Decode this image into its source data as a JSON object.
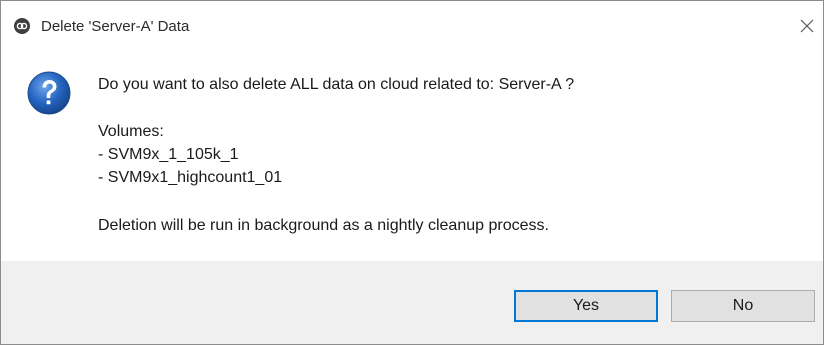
{
  "window": {
    "title": "Delete 'Server-A' Data",
    "app_icon": "app-logo-icon",
    "close_icon": "close-icon"
  },
  "message": {
    "icon": "question-icon",
    "question": "Do you want to also delete ALL data on cloud related to: Server-A ?",
    "volumes_header": "Volumes:",
    "volumes": [
      "- SVM9x_1_105k_1",
      "- SVM9x1_highcount1_01"
    ],
    "note": "Deletion will be run in background as a nightly cleanup process."
  },
  "buttons": {
    "yes_label": "Yes",
    "no_label": "No"
  },
  "colors": {
    "default_button_border": "#0078d7",
    "question_icon_blue": "#1e5fb4"
  }
}
